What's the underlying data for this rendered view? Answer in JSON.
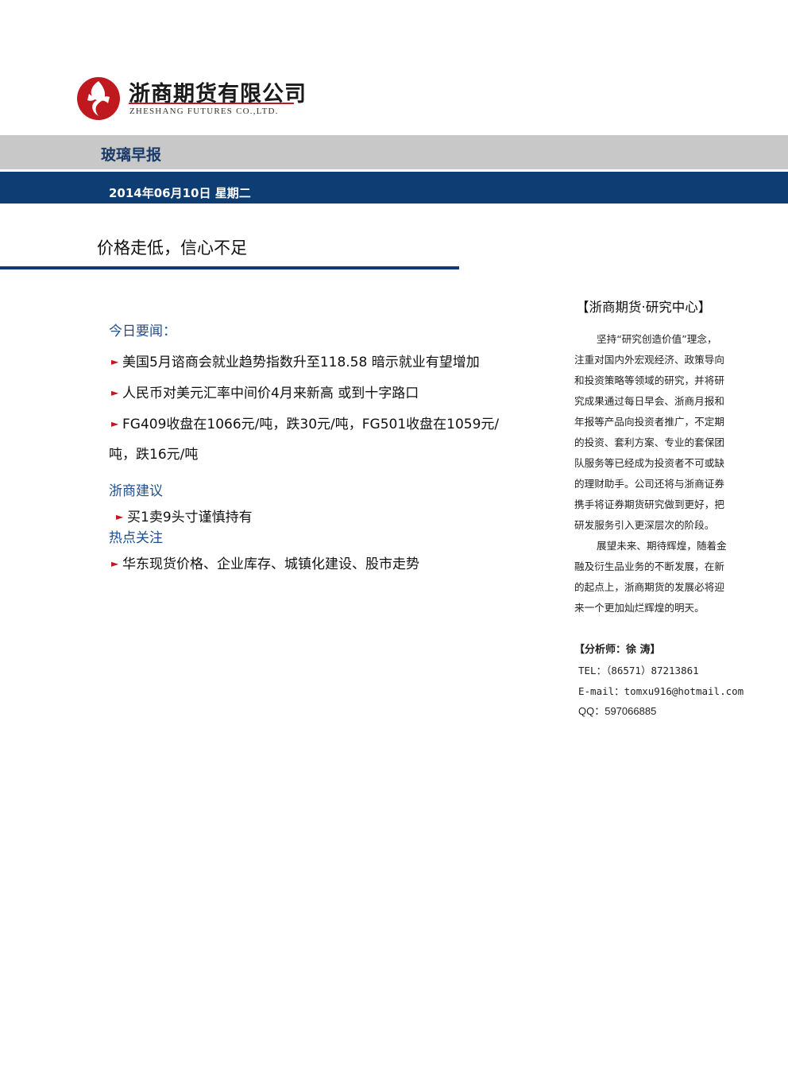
{
  "header": {
    "company_cn": "浙商期货有限公司",
    "company_en": "ZHESHANG FUTURES CO.,LTD.",
    "brand_color": "#c0181f",
    "navy_color": "#0e3d73"
  },
  "report": {
    "title": "玻璃早报",
    "date": "2014年06月10日  星期二"
  },
  "headline": "价格走低，信心不足",
  "news": {
    "title": "今日要闻：",
    "items": [
      "美国5月谘商会就业趋势指数升至118.58 暗示就业有望增加",
      "人民币对美元汇率中间价4月来新高 或到十字路口",
      "FG409收盘在1066元/吨，跌30元/吨，FG501收盘在1059元/"
    ],
    "item3_cont": "吨，跌16元/吨"
  },
  "advice": {
    "title": "浙商建议",
    "items": [
      "买1卖9头寸谨慎持有"
    ]
  },
  "focus": {
    "title": "热点关注",
    "items": [
      "华东现货价格、企业库存、城镇化建设、股市走势"
    ]
  },
  "sidebar": {
    "title": "【浙商期货·研究中心】",
    "lines": [
      "坚持“研究创造价值”理念，",
      "注重对国内外宏观经济、政策导向",
      "和投资策略等领域的研究，并将研",
      "究成果通过每日早会、浙商月报和",
      "年报等产品向投资者推广，不定期",
      "的投资、套利方案、专业的套保团",
      "队服务等已经成为投资者不可或缺",
      "的理财助手。公司还将与浙商证券",
      "携手将证券期货研究做到更好，把",
      "研发服务引入更深层次的阶段。",
      "展望未来、期待辉煌，随着金",
      "融及衍生品业务的不断发展，在新",
      "的起点上，浙商期货的发展必将迎",
      "来一个更加灿烂辉煌的明天。"
    ],
    "analyst": "【分析师：徐 涛】",
    "tel": "TEL：（86571）87213861",
    "email": "E-mail：tomxu916@hotmail.com",
    "qq": "QQ：597066885"
  }
}
